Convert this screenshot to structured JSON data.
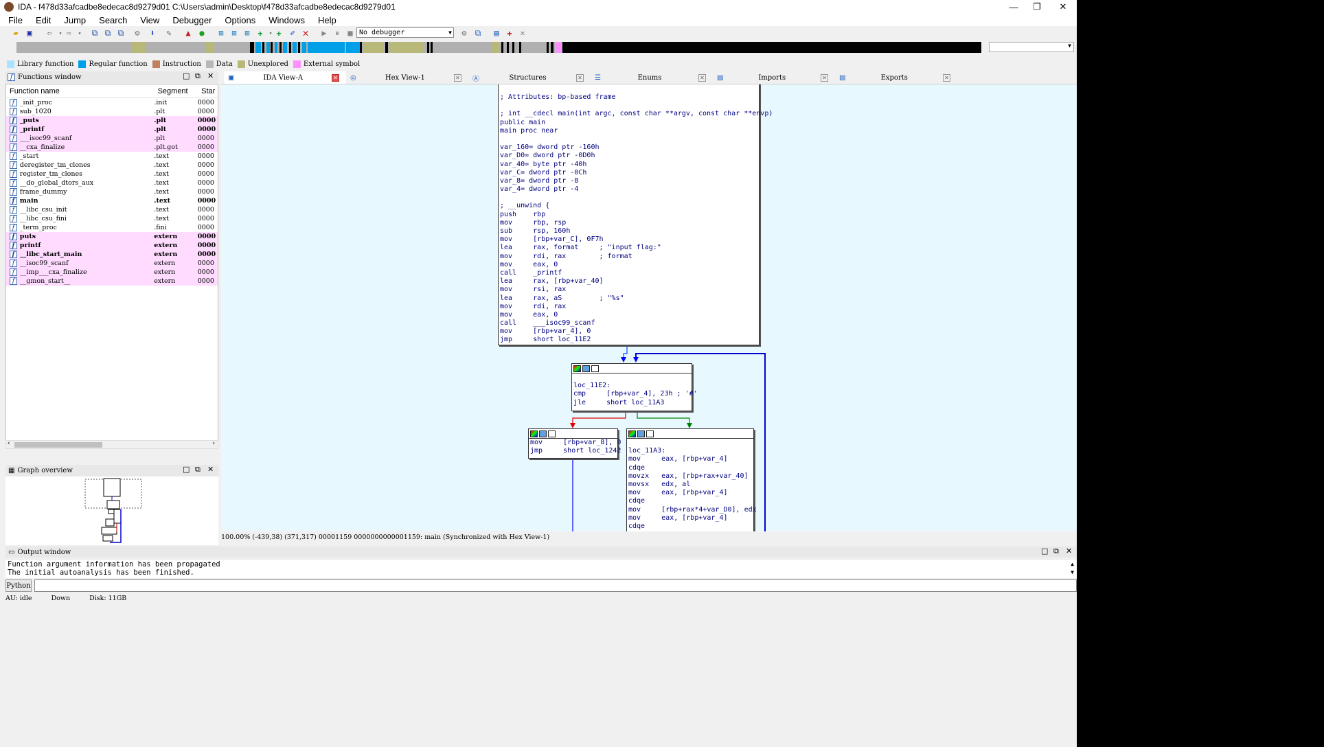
{
  "window": {
    "title": "IDA - f478d33afcadbe8edecac8d9279d01 C:\\Users\\admin\\Desktop\\f478d33afcadbe8edecac8d9279d01",
    "minimize": "—",
    "restore": "❐",
    "close": "✕"
  },
  "menu": [
    "File",
    "Edit",
    "Jump",
    "Search",
    "View",
    "Debugger",
    "Options",
    "Windows",
    "Help"
  ],
  "toolbar": {
    "debugger_select": "No debugger"
  },
  "legend": [
    {
      "label": "Library function",
      "color": "#a8e4ff"
    },
    {
      "label": "Regular function",
      "color": "#00a0e8"
    },
    {
      "label": "Instruction",
      "color": "#c08060"
    },
    {
      "label": "Data",
      "color": "#b8b8b8"
    },
    {
      "label": "Unexplored",
      "color": "#b8b878"
    },
    {
      "label": "External symbol",
      "color": "#ff90ff"
    }
  ],
  "functions_window": {
    "title": "Functions window",
    "columns": [
      "Function name",
      "Segment",
      "Star"
    ],
    "rows": [
      {
        "name": "_init_proc",
        "seg": ".init",
        "start": "0000",
        "ext": false,
        "bold": false
      },
      {
        "name": "sub_1020",
        "seg": ".plt",
        "start": "0000",
        "ext": false,
        "bold": false
      },
      {
        "name": "_puts",
        "seg": ".plt",
        "start": "0000",
        "ext": true,
        "bold": true
      },
      {
        "name": "_printf",
        "seg": ".plt",
        "start": "0000",
        "ext": true,
        "bold": true
      },
      {
        "name": "___isoc99_scanf",
        "seg": ".plt",
        "start": "0000",
        "ext": true,
        "bold": false
      },
      {
        "name": "__cxa_finalize",
        "seg": ".plt.got",
        "start": "0000",
        "ext": true,
        "bold": false
      },
      {
        "name": "_start",
        "seg": ".text",
        "start": "0000",
        "ext": false,
        "bold": false
      },
      {
        "name": "deregister_tm_clones",
        "seg": ".text",
        "start": "0000",
        "ext": false,
        "bold": false
      },
      {
        "name": "register_tm_clones",
        "seg": ".text",
        "start": "0000",
        "ext": false,
        "bold": false
      },
      {
        "name": "__do_global_dtors_aux",
        "seg": ".text",
        "start": "0000",
        "ext": false,
        "bold": false
      },
      {
        "name": "frame_dummy",
        "seg": ".text",
        "start": "0000",
        "ext": false,
        "bold": false
      },
      {
        "name": "main",
        "seg": ".text",
        "start": "0000",
        "ext": false,
        "bold": true
      },
      {
        "name": "__libc_csu_init",
        "seg": ".text",
        "start": "0000",
        "ext": false,
        "bold": false
      },
      {
        "name": "__libc_csu_fini",
        "seg": ".text",
        "start": "0000",
        "ext": false,
        "bold": false
      },
      {
        "name": "_term_proc",
        "seg": ".fini",
        "start": "0000",
        "ext": false,
        "bold": false
      },
      {
        "name": "puts",
        "seg": "extern",
        "start": "0000",
        "ext": true,
        "bold": true
      },
      {
        "name": "printf",
        "seg": "extern",
        "start": "0000",
        "ext": true,
        "bold": true
      },
      {
        "name": "__libc_start_main",
        "seg": "extern",
        "start": "0000",
        "ext": true,
        "bold": true
      },
      {
        "name": "__isoc99_scanf",
        "seg": "extern",
        "start": "0000",
        "ext": true,
        "bold": false
      },
      {
        "name": "__imp___cxa_finalize",
        "seg": "extern",
        "start": "0000",
        "ext": true,
        "bold": false
      },
      {
        "name": "__gmon_start__",
        "seg": "extern",
        "start": "0000",
        "ext": true,
        "bold": false
      }
    ]
  },
  "graph_overview": {
    "title": "Graph overview"
  },
  "tabs": [
    {
      "label": "IDA View-A",
      "active": true
    },
    {
      "label": "Hex View-1",
      "active": false
    },
    {
      "label": "Structures",
      "active": false
    },
    {
      "label": "Enums",
      "active": false
    },
    {
      "label": "Imports",
      "active": false
    },
    {
      "label": "Exports",
      "active": false
    }
  ],
  "graph": {
    "block1": [
      "; Attributes: bp-based frame",
      "",
      "; int __cdecl main(int argc, const char **argv, const char **envp)",
      "public main",
      "main proc near",
      "",
      "var_160= dword ptr -160h",
      "var_D0= dword ptr -0D0h",
      "var_40= byte ptr -40h",
      "var_C= dword ptr -0Ch",
      "var_8= dword ptr -8",
      "var_4= dword ptr -4",
      "",
      "; __unwind {",
      "push    rbp",
      "mov     rbp, rsp",
      "sub     rsp, 160h",
      "mov     [rbp+var_C], 0F7h",
      "lea     rax, format     ; \"input flag:\"",
      "mov     rdi, rax        ; format",
      "mov     eax, 0",
      "call    _printf",
      "lea     rax, [rbp+var_40]",
      "mov     rsi, rax",
      "lea     rax, aS         ; \"%s\"",
      "mov     rdi, rax",
      "mov     eax, 0",
      "call    ___isoc99_scanf",
      "mov     [rbp+var_4], 0",
      "jmp     short loc_11E2"
    ],
    "block2": [
      "",
      "loc_11E2:",
      "cmp     [rbp+var_4], 23h ; '#'",
      "jle     short loc_11A3"
    ],
    "block3": [
      "mov     [rbp+var_8], 0",
      "jmp     short loc_1242"
    ],
    "block4": [
      "",
      "loc_11A3:",
      "mov     eax, [rbp+var_4]",
      "cdqe",
      "movzx   eax, [rbp+rax+var_40]",
      "movsx   edx, al",
      "mov     eax, [rbp+var_4]",
      "cdqe",
      "mov     [rbp+rax*4+var_D0], edx",
      "mov     eax, [rbp+var_4]",
      "cdqe"
    ]
  },
  "status_line": "100.00% (-439,38) (371,317) 00001159 0000000000001159: main (Synchronized with Hex View-1)",
  "output_window": {
    "title": "Output window",
    "lines": [
      "Function argument information has been propagated",
      "The initial autoanalysis has been finished."
    ],
    "python_btn": "Python"
  },
  "statusbar": {
    "au": "AU:  idle",
    "dir": "Down",
    "disk": "Disk: 11GB"
  }
}
